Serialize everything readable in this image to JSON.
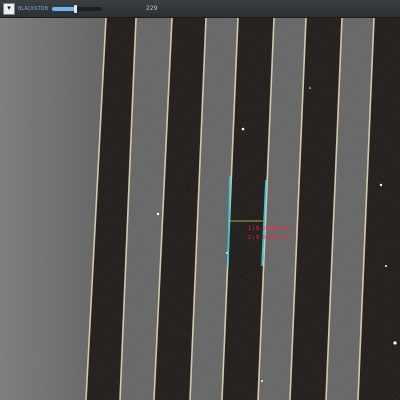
{
  "toolbar": {
    "dropdown_icon": "chevron-down-icon",
    "slider_label": "BLACKSTOB",
    "slider_value": "229",
    "slider_fraction": 0.45
  },
  "measurement": {
    "line1": "1 | 5: 0.0856 um",
    "line2": "2 | 5: 0.0856 um",
    "colors": {
      "edge": "#33c8d8",
      "crosshair": "#b8e05a",
      "text": "#ff2a2a"
    }
  },
  "colors": {
    "toolbar": "#30353a",
    "slider_accent": "#6fb6ee",
    "background_gray": "#6b6b6b",
    "stripe_dark": "#1a1512",
    "stripe_edge": "#e8d9b8"
  }
}
